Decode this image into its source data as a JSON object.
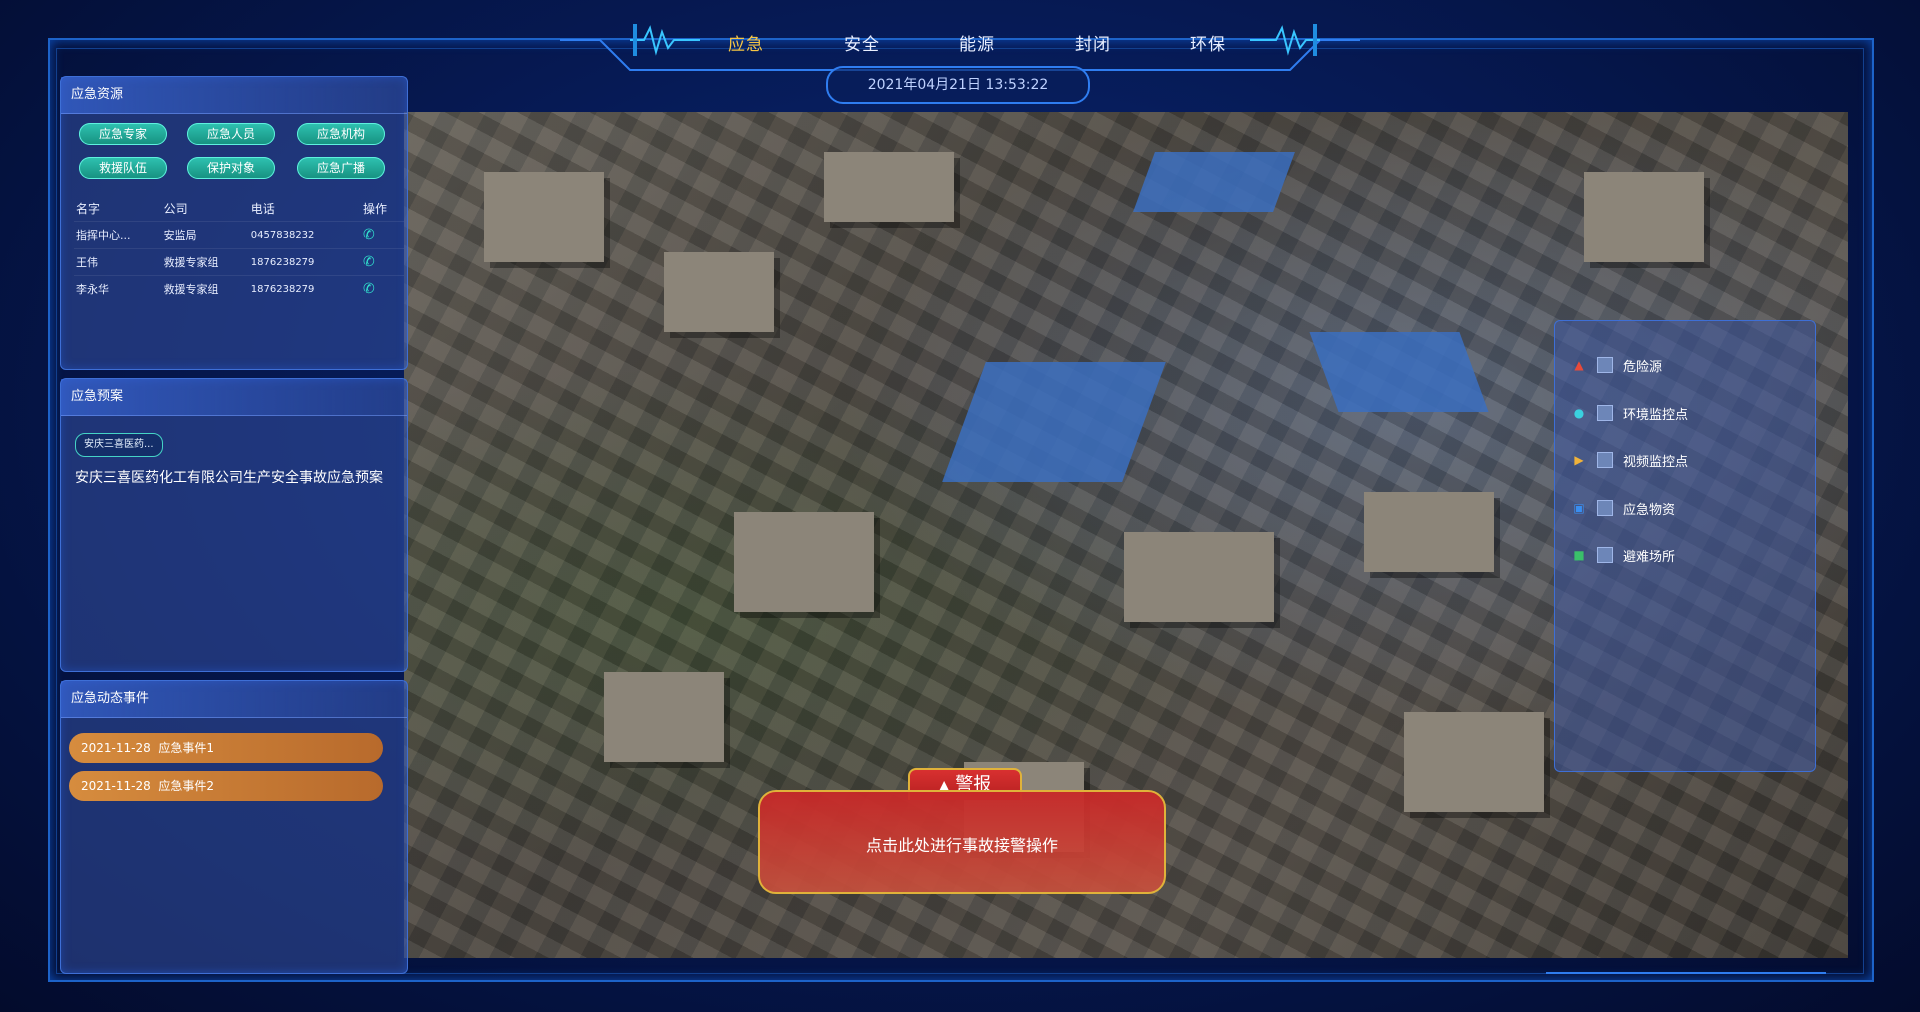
{
  "nav": {
    "tabs": [
      {
        "label": "应急",
        "active": true
      },
      {
        "label": "安全",
        "active": false
      },
      {
        "label": "能源",
        "active": false
      },
      {
        "label": "封闭",
        "active": false
      },
      {
        "label": "环保",
        "active": false
      }
    ],
    "datetime": "2021年04月21日 13:53:22"
  },
  "resources": {
    "title": "应急资源",
    "tags": [
      "应急专家",
      "应急人员",
      "应急机构",
      "救援队伍",
      "保护对象",
      "应急广播"
    ],
    "columns": [
      "名字",
      "公司",
      "电话",
      "操作"
    ],
    "rows": [
      {
        "name": "指挥中心...",
        "company": "安监局",
        "phone": "0457838232"
      },
      {
        "name": "王伟",
        "company": "救援专家组",
        "phone": "1876238279"
      },
      {
        "name": "李永华",
        "company": "救援专家组",
        "phone": "1876238279"
      }
    ]
  },
  "plans": {
    "title": "应急预案",
    "tag": "安庆三喜医药...",
    "text": "安庆三喜医药化工有限公司生产安全事故应急预案"
  },
  "events": {
    "title": "应急动态事件",
    "items": [
      {
        "date": "2021-11-28",
        "name": "应急事件1"
      },
      {
        "date": "2021-11-28",
        "name": "应急事件2"
      }
    ]
  },
  "legend": {
    "items": [
      {
        "label": "危险源",
        "icon": "fire-icon",
        "color": "#e84a3a"
      },
      {
        "label": "环境监控点",
        "icon": "thermometer-icon",
        "color": "#3ad1e0"
      },
      {
        "label": "视频监控点",
        "icon": "video-icon",
        "color": "#f0b23a"
      },
      {
        "label": "应急物资",
        "icon": "truck-icon",
        "color": "#3a8ef0"
      },
      {
        "label": "避难场所",
        "icon": "shelter-icon",
        "color": "#3ac06a"
      }
    ]
  },
  "alarm": {
    "title": "警报",
    "text": "点击此处进行事故接警操作"
  },
  "colors": {
    "accent": "#f6c544",
    "frame": "#1d63c9",
    "teal": "#2fc3b2",
    "event": "#d68c3e",
    "alarm": "#c82828"
  }
}
